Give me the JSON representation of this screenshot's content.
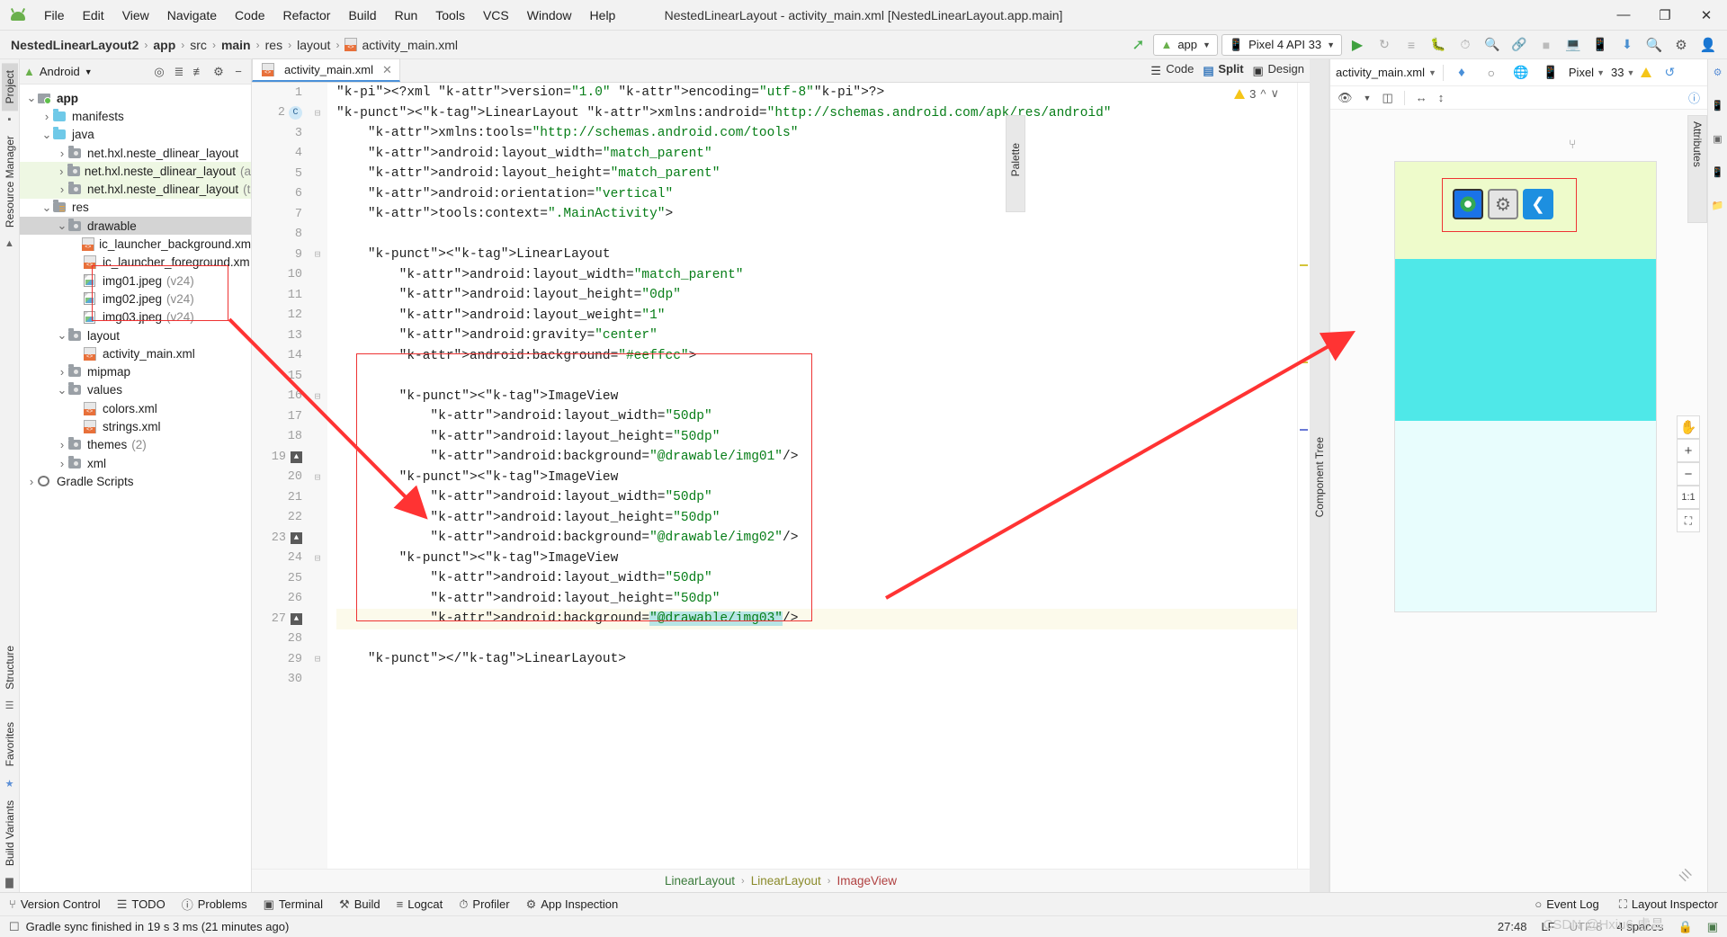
{
  "window": {
    "title": "NestedLinearLayout - activity_main.xml [NestedLinearLayout.app.main]",
    "minimize": "—",
    "maximize": "❐",
    "close": "✕"
  },
  "menubar": {
    "logo": "android-logo-icon",
    "items": [
      "File",
      "Edit",
      "View",
      "Navigate",
      "Code",
      "Refactor",
      "Build",
      "Run",
      "Tools",
      "VCS",
      "Window",
      "Help"
    ]
  },
  "navbar": {
    "breadcrumbs": [
      {
        "label": "NestedLinearLayout2",
        "bold": true
      },
      {
        "label": "app",
        "bold": true
      },
      {
        "label": "src",
        "bold": false
      },
      {
        "label": "main",
        "bold": true
      },
      {
        "label": "res",
        "bold": false
      },
      {
        "label": "layout",
        "bold": false
      },
      {
        "label": "activity_main.xml",
        "bold": false,
        "icon": "xml-file-icon"
      }
    ],
    "module_selector": "app",
    "device_selector": "Pixel 4 API 33",
    "icons": [
      "build-hammer-icon",
      "run-icon",
      "apply-changes-icon",
      "run-tests-icon",
      "debug-icon",
      "profile-icon",
      "more-run-icon",
      "stop-icon",
      "device-manager-icon",
      "avd-icon",
      "sdk-icon",
      "search-icon",
      "settings-icon",
      "account-icon"
    ]
  },
  "left_strip": {
    "items": [
      {
        "label": "Project",
        "selected": true
      },
      {
        "label": "Resource Manager",
        "selected": false
      }
    ],
    "bottom_items": [
      {
        "label": "Structure"
      },
      {
        "label": "Favorites"
      },
      {
        "label": "Build Variants"
      }
    ]
  },
  "right_strip": {
    "items": [
      "Gradle",
      "Device Manager",
      "Layout Validation",
      "Emulator",
      "Device File Explorer"
    ]
  },
  "project_panel": {
    "title": "Android",
    "header_icons": [
      "locate-icon",
      "expand-all-icon",
      "collapse-all-icon",
      "settings-icon",
      "hide-icon"
    ],
    "tree": [
      {
        "indent": 0,
        "arrow": "down",
        "icon": "app-module-icon",
        "label": "app",
        "bold": true,
        "hint": "",
        "state": ""
      },
      {
        "indent": 1,
        "arrow": "right",
        "icon": "folder-blue-icon",
        "label": "manifests",
        "bold": false,
        "hint": "",
        "state": ""
      },
      {
        "indent": 1,
        "arrow": "down",
        "icon": "folder-blue-icon",
        "label": "java",
        "bold": false,
        "hint": "",
        "state": ""
      },
      {
        "indent": 2,
        "arrow": "right",
        "icon": "package-icon",
        "label": "net.hxl.neste_dlinear_layout",
        "bold": false,
        "hint": "",
        "state": ""
      },
      {
        "indent": 2,
        "arrow": "right",
        "icon": "package-icon",
        "label": "net.hxl.neste_dlinear_layout",
        "bold": false,
        "hint": "(a",
        "state": "green"
      },
      {
        "indent": 2,
        "arrow": "right",
        "icon": "package-icon",
        "label": "net.hxl.neste_dlinear_layout",
        "bold": false,
        "hint": "(t",
        "state": "green"
      },
      {
        "indent": 1,
        "arrow": "down",
        "icon": "res-folder-icon",
        "label": "res",
        "bold": false,
        "hint": "",
        "state": ""
      },
      {
        "indent": 2,
        "arrow": "down",
        "icon": "folder-icon",
        "label": "drawable",
        "bold": false,
        "hint": "",
        "state": "grey"
      },
      {
        "indent": 3,
        "arrow": "none",
        "icon": "xml-file-icon",
        "label": "ic_launcher_background.xm",
        "bold": false,
        "hint": "",
        "state": ""
      },
      {
        "indent": 3,
        "arrow": "none",
        "icon": "xml-file-icon",
        "label": "ic_launcher_foreground.xm",
        "bold": false,
        "hint": "",
        "state": ""
      },
      {
        "indent": 3,
        "arrow": "none",
        "icon": "image-file-icon",
        "label": "img01.jpeg",
        "bold": false,
        "hint": "(v24)",
        "state": ""
      },
      {
        "indent": 3,
        "arrow": "none",
        "icon": "image-file-icon",
        "label": "img02.jpeg",
        "bold": false,
        "hint": "(v24)",
        "state": ""
      },
      {
        "indent": 3,
        "arrow": "none",
        "icon": "image-file-icon",
        "label": "img03.jpeg",
        "bold": false,
        "hint": "(v24)",
        "state": ""
      },
      {
        "indent": 2,
        "arrow": "down",
        "icon": "folder-icon",
        "label": "layout",
        "bold": false,
        "hint": "",
        "state": ""
      },
      {
        "indent": 3,
        "arrow": "none",
        "icon": "xml-file-icon",
        "label": "activity_main.xml",
        "bold": false,
        "hint": "",
        "state": ""
      },
      {
        "indent": 2,
        "arrow": "right",
        "icon": "folder-icon",
        "label": "mipmap",
        "bold": false,
        "hint": "",
        "state": ""
      },
      {
        "indent": 2,
        "arrow": "down",
        "icon": "folder-icon",
        "label": "values",
        "bold": false,
        "hint": "",
        "state": ""
      },
      {
        "indent": 3,
        "arrow": "none",
        "icon": "xml-file-icon",
        "label": "colors.xml",
        "bold": false,
        "hint": "",
        "state": ""
      },
      {
        "indent": 3,
        "arrow": "none",
        "icon": "xml-file-icon",
        "label": "strings.xml",
        "bold": false,
        "hint": "",
        "state": ""
      },
      {
        "indent": 2,
        "arrow": "right",
        "icon": "folder-icon",
        "label": "themes",
        "bold": false,
        "hint": "(2)",
        "state": ""
      },
      {
        "indent": 2,
        "arrow": "right",
        "icon": "folder-icon",
        "label": "xml",
        "bold": false,
        "hint": "",
        "state": ""
      },
      {
        "indent": 0,
        "arrow": "right",
        "icon": "gradle-icon",
        "label": "Gradle Scripts",
        "bold": false,
        "hint": "",
        "state": ""
      }
    ]
  },
  "editor": {
    "tab_label": "activity_main.xml",
    "tab_close": "✕",
    "view_modes": [
      {
        "label": "Code",
        "active": false
      },
      {
        "label": "Split",
        "active": true
      },
      {
        "label": "Design",
        "active": false
      }
    ],
    "warning_count": "3",
    "lines": [
      {
        "n": "1",
        "text": "<?xml version=\"1.0\" encoding=\"utf-8\"?>"
      },
      {
        "n": "2",
        "text": "<LinearLayout xmlns:android=\"http://schemas.android.com/apk/res/android\""
      },
      {
        "n": "3",
        "text": "    xmlns:tools=\"http://schemas.android.com/tools\""
      },
      {
        "n": "4",
        "text": "    android:layout_width=\"match_parent\""
      },
      {
        "n": "5",
        "text": "    android:layout_height=\"match_parent\""
      },
      {
        "n": "6",
        "text": "    android:orientation=\"vertical\""
      },
      {
        "n": "7",
        "text": "    tools:context=\".MainActivity\">"
      },
      {
        "n": "8",
        "text": ""
      },
      {
        "n": "9",
        "text": "    <LinearLayout"
      },
      {
        "n": "10",
        "text": "        android:layout_width=\"match_parent\""
      },
      {
        "n": "11",
        "text": "        android:layout_height=\"0dp\""
      },
      {
        "n": "12",
        "text": "        android:layout_weight=\"1\""
      },
      {
        "n": "13",
        "text": "        android:gravity=\"center\""
      },
      {
        "n": "14",
        "text": "        android:background=\"#eeffcc\">"
      },
      {
        "n": "15",
        "text": ""
      },
      {
        "n": "16",
        "text": "        <ImageView"
      },
      {
        "n": "17",
        "text": "            android:layout_width=\"50dp\""
      },
      {
        "n": "18",
        "text": "            android:layout_height=\"50dp\""
      },
      {
        "n": "19",
        "text": "            android:background=\"@drawable/img01\"/>"
      },
      {
        "n": "20",
        "text": "        <ImageView"
      },
      {
        "n": "21",
        "text": "            android:layout_width=\"50dp\""
      },
      {
        "n": "22",
        "text": "            android:layout_height=\"50dp\""
      },
      {
        "n": "23",
        "text": "            android:background=\"@drawable/img02\"/>"
      },
      {
        "n": "24",
        "text": "        <ImageView"
      },
      {
        "n": "25",
        "text": "            android:layout_width=\"50dp\""
      },
      {
        "n": "26",
        "text": "            android:layout_height=\"50dp\""
      },
      {
        "n": "27",
        "text": "            android:background=\"@drawable/img03\"/>"
      },
      {
        "n": "28",
        "text": ""
      },
      {
        "n": "29",
        "text": "    </LinearLayout>"
      },
      {
        "n": "30",
        "text": ""
      }
    ],
    "breadcrumb": [
      {
        "label": "LinearLayout",
        "color": "green"
      },
      {
        "label": "LinearLayout",
        "color": "olive"
      },
      {
        "label": "ImageView",
        "color": "red"
      }
    ]
  },
  "design": {
    "file_selector": "activity_main.xml",
    "device_selector": "Pixel",
    "api_selector": "33",
    "toolbar_icons": [
      "layers-icon",
      "theme-icon",
      "locale-icon",
      "device-icon",
      "chevron-down-icon",
      "warning-icon",
      "refresh-icon"
    ],
    "toolbar2_icons": [
      "eye-icon",
      "blueprint-icon",
      "horizontal-align-icon",
      "vertical-align-icon",
      "help-icon"
    ],
    "palette_label": "Palette",
    "attributes_label": "Attributes",
    "component_tree_label": "Component Tree",
    "zoom_controls": [
      "pan-icon",
      "zoom-in-icon",
      "zoom-out-icon",
      "zoom-actual-icon",
      "zoom-fit-icon"
    ],
    "zoom_in": "+",
    "zoom_out": "−",
    "zoom_actual": "1:1",
    "zoom_fit": "⛶",
    "preview_sections": [
      {
        "name": "top-linearlayout",
        "color": "#eefbcb"
      },
      {
        "name": "middle-linearlayout",
        "color": "#4fe8e8"
      },
      {
        "name": "bottom-linearlayout",
        "color": "#e8fdfd"
      }
    ],
    "app_icons": [
      "chrome-icon",
      "settings-gear-icon",
      "share-icon"
    ]
  },
  "bottom_tools": {
    "items": [
      {
        "label": "Version Control",
        "icon": "branch-icon"
      },
      {
        "label": "TODO",
        "icon": "list-icon"
      },
      {
        "label": "Problems",
        "icon": "error-icon"
      },
      {
        "label": "Terminal",
        "icon": "terminal-icon"
      },
      {
        "label": "Build",
        "icon": "hammer-icon"
      },
      {
        "label": "Logcat",
        "icon": "logcat-icon"
      },
      {
        "label": "Profiler",
        "icon": "profiler-icon"
      },
      {
        "label": "App Inspection",
        "icon": "inspection-icon"
      }
    ],
    "right_items": [
      {
        "label": "Event Log",
        "icon": "event-log-icon"
      },
      {
        "label": "Layout Inspector",
        "icon": "layout-inspector-icon"
      }
    ]
  },
  "statusbar": {
    "message": "Gradle sync finished in 19 s 3 ms (21 minutes ago)",
    "caret": "27:48",
    "line_sep": "LF",
    "encoding": "UTF-8",
    "indent": "4 spaces",
    "watermark": "CSDN @Hxiu6.虚昌"
  }
}
